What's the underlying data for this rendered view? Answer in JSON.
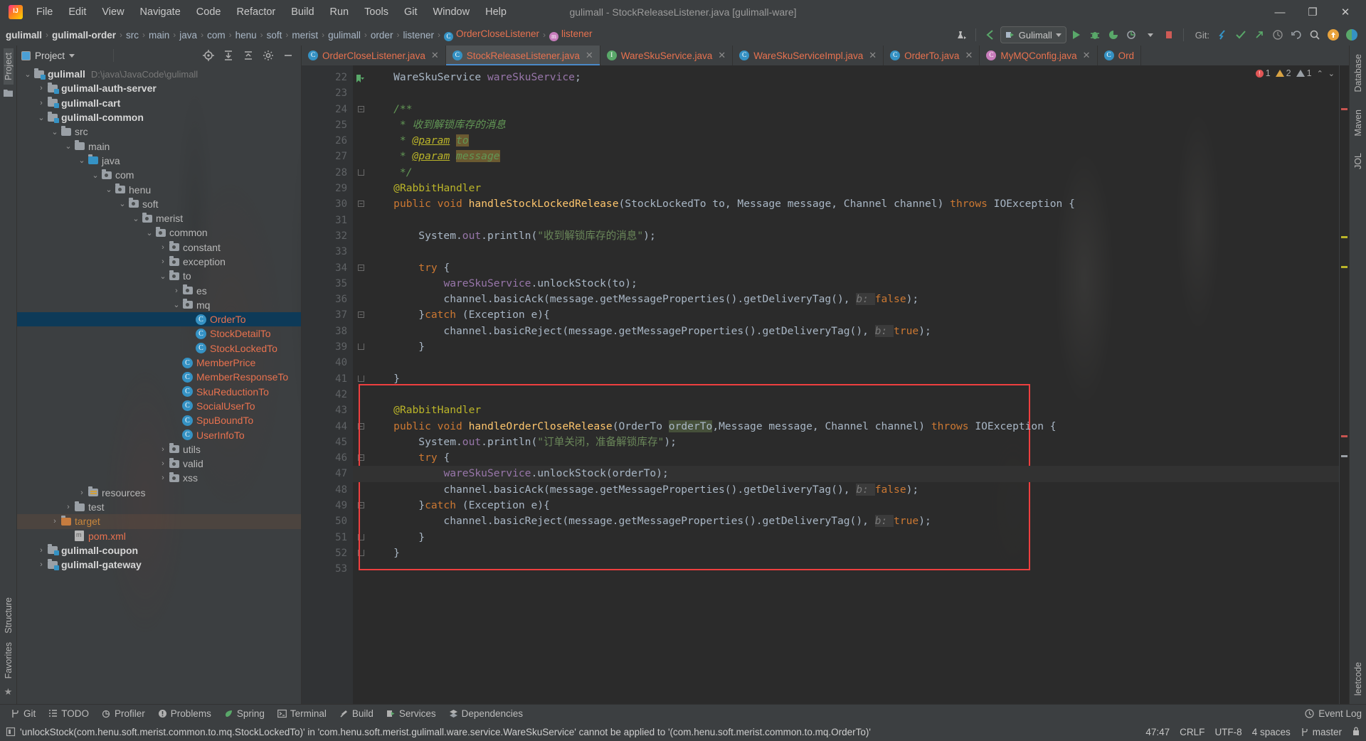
{
  "window": {
    "title": "gulimall - StockReleaseListener.java [gulimall-ware]",
    "minimize": "—",
    "maximize": "❐",
    "close": "✕"
  },
  "menubar": [
    {
      "label": "File"
    },
    {
      "label": "Edit"
    },
    {
      "label": "View"
    },
    {
      "label": "Navigate"
    },
    {
      "label": "Code"
    },
    {
      "label": "Refactor"
    },
    {
      "label": "Build"
    },
    {
      "label": "Run"
    },
    {
      "label": "Tools"
    },
    {
      "label": "Git"
    },
    {
      "label": "Window"
    },
    {
      "label": "Help"
    }
  ],
  "breadcrumb": {
    "items": [
      {
        "label": "gulimall",
        "style": "bold"
      },
      {
        "label": "gulimall-order",
        "style": "bold"
      },
      {
        "label": "src",
        "style": "plain"
      },
      {
        "label": "main",
        "style": "plain"
      },
      {
        "label": "java",
        "style": "plain"
      },
      {
        "label": "com",
        "style": "plain"
      },
      {
        "label": "henu",
        "style": "plain"
      },
      {
        "label": "soft",
        "style": "plain"
      },
      {
        "label": "merist",
        "style": "plain"
      },
      {
        "label": "gulimall",
        "style": "plain"
      },
      {
        "label": "order",
        "style": "plain"
      },
      {
        "label": "listener",
        "style": "plain"
      },
      {
        "label": "OrderCloseListener",
        "style": "class"
      },
      {
        "label": "listener",
        "style": "method"
      }
    ],
    "separator": "›"
  },
  "toolbar": {
    "run_config": "Gulimall",
    "git_label": "Git:",
    "icons": [
      "profile-icon",
      "back-arrow-icon",
      "run-icon",
      "debug-icon",
      "run-with-coverage-icon",
      "profiler-icon",
      "stop-icon",
      "update-project-icon",
      "commit-icon",
      "push-icon",
      "history-icon",
      "rollback-icon",
      "search-everywhere-icon",
      "notification-icon",
      "ide-feature-icon"
    ]
  },
  "left_rail": {
    "top_label": "Project",
    "bottom_labels": [
      "Structure",
      "Favorites"
    ]
  },
  "right_rail": {
    "labels": [
      "Database",
      "Maven",
      "JOL",
      "leetcode"
    ]
  },
  "project_panel": {
    "title": "Project",
    "actions": [
      "locate-icon",
      "expand-all-icon",
      "collapse-all-icon",
      "settings-icon",
      "hide-icon"
    ],
    "tree": [
      {
        "depth": 0,
        "arrow": "down",
        "icon": "module",
        "label": "gulimall",
        "style": "bold",
        "path": "D:\\java\\JavaCode\\gulimall"
      },
      {
        "depth": 1,
        "arrow": "right",
        "icon": "module",
        "label": "gulimall-auth-server",
        "style": "bold"
      },
      {
        "depth": 1,
        "arrow": "right",
        "icon": "module",
        "label": "gulimall-cart",
        "style": "bold"
      },
      {
        "depth": 1,
        "arrow": "down",
        "icon": "module",
        "label": "gulimall-common",
        "style": "bold"
      },
      {
        "depth": 2,
        "arrow": "down",
        "icon": "folder",
        "label": "src",
        "style": "plain"
      },
      {
        "depth": 3,
        "arrow": "down",
        "icon": "folder",
        "label": "main",
        "style": "plain"
      },
      {
        "depth": 4,
        "arrow": "down",
        "icon": "source",
        "label": "java",
        "style": "plain"
      },
      {
        "depth": 5,
        "arrow": "down",
        "icon": "package",
        "label": "com",
        "style": "plain"
      },
      {
        "depth": 6,
        "arrow": "down",
        "icon": "package",
        "label": "henu",
        "style": "plain"
      },
      {
        "depth": 7,
        "arrow": "down",
        "icon": "package",
        "label": "soft",
        "style": "plain"
      },
      {
        "depth": 8,
        "arrow": "down",
        "icon": "package",
        "label": "merist",
        "style": "plain"
      },
      {
        "depth": 9,
        "arrow": "down",
        "icon": "package",
        "label": "common",
        "style": "plain"
      },
      {
        "depth": 10,
        "arrow": "right",
        "icon": "package",
        "label": "constant",
        "style": "plain"
      },
      {
        "depth": 10,
        "arrow": "right",
        "icon": "package",
        "label": "exception",
        "style": "plain"
      },
      {
        "depth": 10,
        "arrow": "down",
        "icon": "package",
        "label": "to",
        "style": "plain"
      },
      {
        "depth": 11,
        "arrow": "right",
        "icon": "package",
        "label": "es",
        "style": "plain"
      },
      {
        "depth": 11,
        "arrow": "down",
        "icon": "package",
        "label": "mq",
        "style": "plain"
      },
      {
        "depth": 12,
        "arrow": "none",
        "icon": "class",
        "label": "OrderTo",
        "style": "class",
        "selected": true
      },
      {
        "depth": 12,
        "arrow": "none",
        "icon": "class",
        "label": "StockDetailTo",
        "style": "class"
      },
      {
        "depth": 12,
        "arrow": "none",
        "icon": "class",
        "label": "StockLockedTo",
        "style": "class"
      },
      {
        "depth": 11,
        "arrow": "none",
        "icon": "class",
        "label": "MemberPrice",
        "style": "class"
      },
      {
        "depth": 11,
        "arrow": "none",
        "icon": "class",
        "label": "MemberResponseTo",
        "style": "class"
      },
      {
        "depth": 11,
        "arrow": "none",
        "icon": "class",
        "label": "SkuReductionTo",
        "style": "class"
      },
      {
        "depth": 11,
        "arrow": "none",
        "icon": "class",
        "label": "SocialUserTo",
        "style": "class"
      },
      {
        "depth": 11,
        "arrow": "none",
        "icon": "class",
        "label": "SpuBoundTo",
        "style": "class"
      },
      {
        "depth": 11,
        "arrow": "none",
        "icon": "class",
        "label": "UserInfoTo",
        "style": "class"
      },
      {
        "depth": 10,
        "arrow": "right",
        "icon": "package",
        "label": "utils",
        "style": "plain"
      },
      {
        "depth": 10,
        "arrow": "right",
        "icon": "package",
        "label": "valid",
        "style": "plain"
      },
      {
        "depth": 10,
        "arrow": "right",
        "icon": "package",
        "label": "xss",
        "style": "plain"
      },
      {
        "depth": 4,
        "arrow": "right",
        "icon": "resources",
        "label": "resources",
        "style": "plain"
      },
      {
        "depth": 3,
        "arrow": "right",
        "icon": "folder",
        "label": "test",
        "style": "plain"
      },
      {
        "depth": 2,
        "arrow": "right",
        "icon": "target",
        "label": "target",
        "style": "target",
        "highlight": true
      },
      {
        "depth": 3,
        "arrow": "none",
        "icon": "xml",
        "label": "pom.xml",
        "style": "xml"
      },
      {
        "depth": 1,
        "arrow": "right",
        "icon": "module",
        "label": "gulimall-coupon",
        "style": "bold"
      },
      {
        "depth": 1,
        "arrow": "right",
        "icon": "module",
        "label": "gulimall-gateway",
        "style": "bold"
      }
    ]
  },
  "tabs": [
    {
      "label": "OrderCloseListener.java",
      "icon": "class",
      "active": false,
      "close": "✕"
    },
    {
      "label": "StockReleaseListener.java",
      "icon": "class",
      "active": true,
      "close": "✕"
    },
    {
      "label": "WareSkuService.java",
      "icon": "interface",
      "active": false,
      "close": "✕"
    },
    {
      "label": "WareSkuServiceImpl.java",
      "icon": "class",
      "active": false,
      "close": "✕"
    },
    {
      "label": "OrderTo.java",
      "icon": "class",
      "active": false,
      "close": "✕"
    },
    {
      "label": "MyMQConfig.java",
      "icon": "config",
      "active": false,
      "close": "✕"
    },
    {
      "label": "Ord",
      "icon": "class",
      "active": false,
      "close": ""
    }
  ],
  "editor": {
    "inspection": {
      "errors": "1",
      "warnings": "2",
      "weak_warnings": "1"
    },
    "first_line_number": 22,
    "lines": [
      {
        "n": 22,
        "text": "    WareSkuService wareSkuService;",
        "bookmark": true
      },
      {
        "n": 23,
        "text": ""
      },
      {
        "n": 24,
        "text": "    /**",
        "fold": "open"
      },
      {
        "n": 25,
        "text": "     * 收到解锁库存的消息"
      },
      {
        "n": 26,
        "text": "     * @param to"
      },
      {
        "n": 27,
        "text": "     * @param message"
      },
      {
        "n": 28,
        "text": "     */",
        "fold": "close"
      },
      {
        "n": 29,
        "text": "    @RabbitHandler"
      },
      {
        "n": 30,
        "text": "    public void handleStockLockedRelease(StockLockedTo to, Message message, Channel channel) throws IOException {",
        "fold": "open"
      },
      {
        "n": 31,
        "text": ""
      },
      {
        "n": 32,
        "text": "        System.out.println(\"收到解锁库存的消息\");"
      },
      {
        "n": 33,
        "text": ""
      },
      {
        "n": 34,
        "text": "        try {",
        "fold": "open"
      },
      {
        "n": 35,
        "text": "            wareSkuService.unlockStock(to);"
      },
      {
        "n": 36,
        "text": "            channel.basicAck(message.getMessageProperties().getDeliveryTag(), b: false);"
      },
      {
        "n": 37,
        "text": "        }catch (Exception e){",
        "fold": "open"
      },
      {
        "n": 38,
        "text": "            channel.basicReject(message.getMessageProperties().getDeliveryTag(), b: true);"
      },
      {
        "n": 39,
        "text": "        }",
        "fold": "close"
      },
      {
        "n": 40,
        "text": ""
      },
      {
        "n": 41,
        "text": "    }",
        "fold": "close"
      },
      {
        "n": 42,
        "text": ""
      },
      {
        "n": 43,
        "text": "    @RabbitHandler"
      },
      {
        "n": 44,
        "text": "    public void handleOrderCloseRelease(OrderTo orderTo,Message message, Channel channel) throws IOException {",
        "fold": "open"
      },
      {
        "n": 45,
        "text": "        System.out.println(\"订单关闭，准备解锁库存\");"
      },
      {
        "n": 46,
        "text": "        try {",
        "fold": "open"
      },
      {
        "n": 47,
        "text": "            wareSkuService.unlockStock(orderTo);",
        "caret": true
      },
      {
        "n": 48,
        "text": "            channel.basicAck(message.getMessageProperties().getDeliveryTag(), b: false);"
      },
      {
        "n": 49,
        "text": "        }catch (Exception e){",
        "fold": "open"
      },
      {
        "n": 50,
        "text": "            channel.basicReject(message.getMessageProperties().getDeliveryTag(), b: true);"
      },
      {
        "n": 51,
        "text": "        }",
        "fold": "close"
      },
      {
        "n": 52,
        "text": "    }",
        "fold": "close"
      },
      {
        "n": 53,
        "text": ""
      }
    ]
  },
  "bottom_tools": [
    {
      "label": "Git",
      "icon": "git-branch-icon"
    },
    {
      "label": "TODO",
      "icon": "todo-list-icon"
    },
    {
      "label": "Profiler",
      "icon": "profiler-icon"
    },
    {
      "label": "Problems",
      "icon": "problems-icon"
    },
    {
      "label": "Spring",
      "icon": "spring-leaf-icon"
    },
    {
      "label": "Terminal",
      "icon": "terminal-icon"
    },
    {
      "label": "Build",
      "icon": "build-hammer-icon"
    },
    {
      "label": "Services",
      "icon": "services-icon"
    },
    {
      "label": "Dependencies",
      "icon": "dependencies-icon"
    }
  ],
  "bottom_right": {
    "label": "Event Log",
    "icon": "event-log-icon"
  },
  "statusbar": {
    "message": "'unlockStock(com.henu.soft.merist.common.to.mq.StockLockedTo)' in 'com.henu.soft.merist.gulimall.ware.service.WareSkuService' cannot be applied to '(com.henu.soft.merist.common.to.mq.OrderTo)'",
    "position": "47:47",
    "line_separator": "CRLF",
    "encoding": "UTF-8",
    "indent": "4 spaces",
    "branch": "master",
    "lock_icon": "lock-icon",
    "message_icon": "inspection-icon"
  },
  "colors": {
    "accent": "#4a88c7",
    "error": "#ee3f3f",
    "class_name": "#e8724f",
    "selection": "#0d3a58"
  }
}
